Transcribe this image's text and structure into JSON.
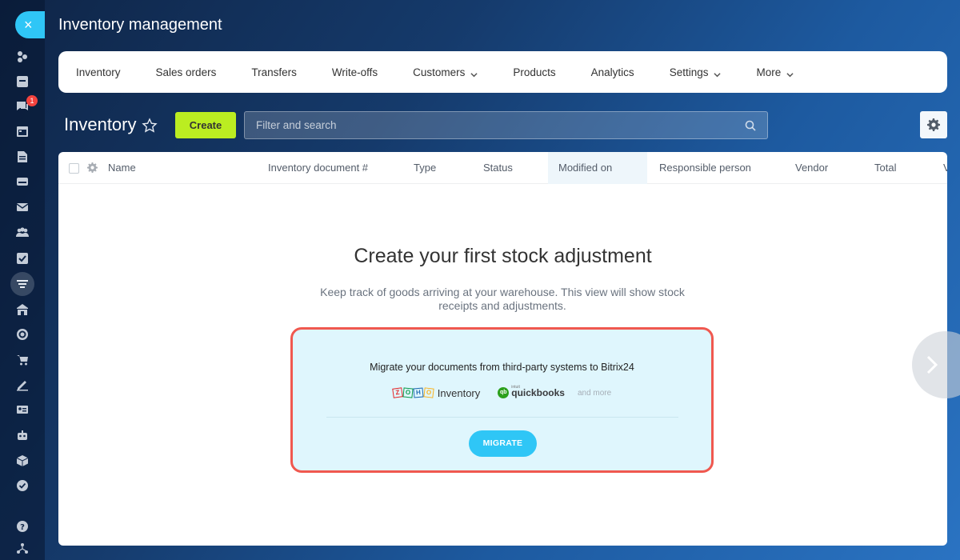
{
  "app": {
    "title": "Inventory management"
  },
  "topnav": {
    "items": [
      {
        "label": "Inventory",
        "dropdown": false
      },
      {
        "label": "Sales orders",
        "dropdown": false
      },
      {
        "label": "Transfers",
        "dropdown": false
      },
      {
        "label": "Write-offs",
        "dropdown": false
      },
      {
        "label": "Customers",
        "dropdown": true
      },
      {
        "label": "Products",
        "dropdown": false
      },
      {
        "label": "Analytics",
        "dropdown": false
      },
      {
        "label": "Settings",
        "dropdown": true
      },
      {
        "label": "More",
        "dropdown": true
      }
    ]
  },
  "rail": {
    "close_label": "×",
    "notification_count": "1"
  },
  "toolbar": {
    "page_title": "Inventory",
    "create_label": "Create",
    "search_placeholder": "Filter and search"
  },
  "table": {
    "columns": [
      "Name",
      "Inventory document #",
      "Type",
      "Status",
      "Modified on",
      "Responsible person",
      "Vendor",
      "Total",
      "V"
    ],
    "sorted_column": "Modified on"
  },
  "empty_state": {
    "title": "Create your first stock adjustment",
    "description": "Keep track of goods arriving at your warehouse. This view will show stock receipts and adjustments."
  },
  "migrate": {
    "title": "Migrate your documents from third-party systems to Bitrix24",
    "zoho_letters": [
      "Z",
      "O",
      "H",
      "O"
    ],
    "zoho_product": "Inventory",
    "qb_tag": "intuit",
    "qb_name": "quickbooks",
    "and_more": "and more",
    "button_label": "MIGRATE"
  },
  "colors": {
    "accent": "#2fc6f6",
    "create_button": "#bbed21",
    "highlight_border": "#f0584f",
    "card_bg": "#dff6fd",
    "zoho": [
      "#e42527",
      "#089949",
      "#226db4",
      "#f9b21d"
    ]
  }
}
